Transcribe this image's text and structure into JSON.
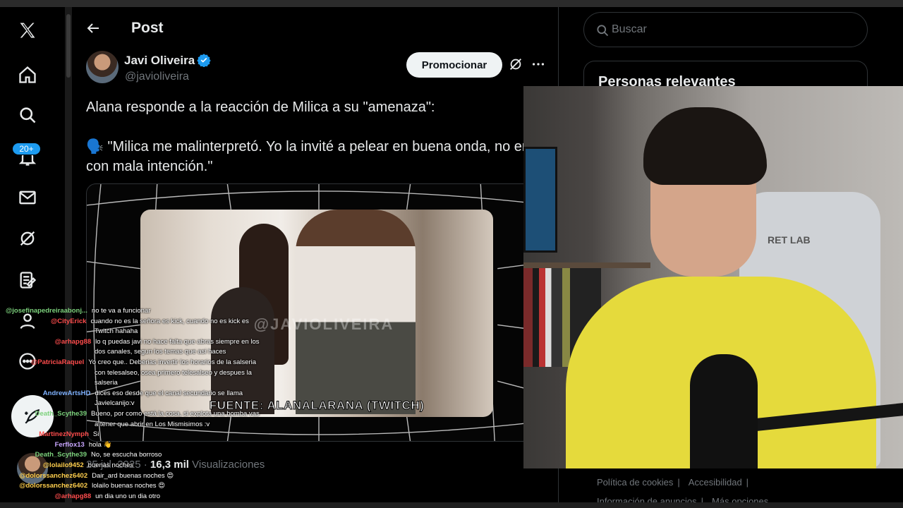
{
  "nav": {
    "notifications_badge": "20+"
  },
  "header": {
    "title": "Post"
  },
  "post": {
    "author_name": "Javi Oliveira",
    "author_handle": "@javioliveira",
    "promote_label": "Promocionar",
    "text_line1": "Alana responde a la reacción de Milica a su \"amenaza\":",
    "text_line2": "🗣️ \"Milica me malinterpretó. Yo la invité a pelear en buena onda, no era con mala intención.\"",
    "video_watermark": "@JAVIOLIVEIRA",
    "video_caption": "FUENTE: ALANALARANA (TWITCH)",
    "date": "25 jul. 2025",
    "views_count": "16,3 mil",
    "views_label": "Visualizaciones"
  },
  "right": {
    "search_placeholder": "Buscar",
    "relevant_title": "Personas relevantes",
    "footer": {
      "cookies": "Política de cookies",
      "accessibility": "Accesibilidad",
      "ads_info": "Información de anuncios",
      "more": "Más opciones ..."
    }
  },
  "webcam": {
    "chair_label": "RET LAB"
  },
  "chat": [
    {
      "user": "@josefinapedreiraabonj...",
      "msg": "no te va a funcionar",
      "color": "#7cd17c"
    },
    {
      "user": "@CityErick",
      "msg": "cuando no es la señora es kick, cuando no es kick es",
      "color": "#ff4d4d"
    },
    {
      "user": "",
      "msg": "Twitch hahaha",
      "color": "#ffffff"
    },
    {
      "user": "@arhapg88",
      "msg": "lo q puedas javi no hace falta que abras siempre en los",
      "color": "#ff4d4d"
    },
    {
      "user": "",
      "msg": "dos canales, segun los temas que asi haces",
      "color": "#ffffff"
    },
    {
      "user": "@PatriciaRaquel",
      "msg": "Yo creo que.. Deberias invertir los horarios de la salseria",
      "color": "#ff4d4d"
    },
    {
      "user": "",
      "msg": "con telesalseo, osea primero telesalseo y despues la",
      "color": "#ffffff"
    },
    {
      "user": "",
      "msg": "salseria",
      "color": "#ffffff"
    },
    {
      "user": "AndrewArtsHD",
      "msg": "dices eso desde que el canal secundario se llama",
      "color": "#7fb2ff"
    },
    {
      "user": "",
      "msg": "Javielcanijo:v",
      "color": "#ffffff"
    },
    {
      "user": "Death_Scythe39",
      "msg": "Bueno, por como está la cosa, si explota una bomba vas",
      "color": "#7cd17c"
    },
    {
      "user": "",
      "msg": "a tener que abrir en Los Mismisimos :v",
      "color": "#ffffff"
    },
    {
      "user": "MartinezNymph",
      "msg": "Si",
      "color": "#ff4d4d"
    },
    {
      "user": "Ferflox13",
      "msg": "hola 👋",
      "color": "#c9a6ff"
    },
    {
      "user": "Death_Scythe39",
      "msg": "No, se escucha borroso",
      "color": "#7cd17c"
    },
    {
      "user": "@lolailo9452",
      "msg": "buenas noches",
      "color": "#ffcf4d"
    },
    {
      "user": "@dolorssanchez6402",
      "msg": "Dair_ard buenas noches 😍",
      "color": "#ffcf4d"
    },
    {
      "user": "@dolorssanchez6402",
      "msg": "lolailo buenas noches 😍",
      "color": "#ffcf4d"
    },
    {
      "user": "@arhapg88",
      "msg": "un dia uno un dia otro",
      "color": "#ff4d4d"
    }
  ]
}
